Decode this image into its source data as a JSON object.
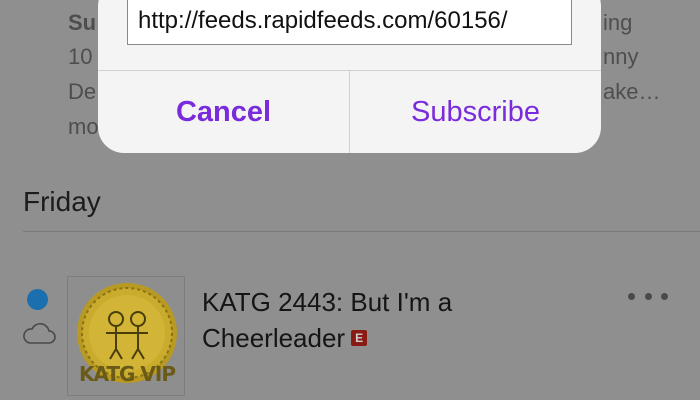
{
  "alert": {
    "url_value": "http://feeds.rapidfeeds.com/60156/",
    "cancel_label": "Cancel",
    "subscribe_label": "Subscribe",
    "accent_color": "#7a2bdc"
  },
  "background": {
    "summary_lines": [
      "Su",
      "10",
      "De",
      "mo"
    ],
    "summary_right_fragments": [
      "ing",
      "nny",
      "ake…"
    ]
  },
  "section": {
    "header": "Friday"
  },
  "episode": {
    "title": "KATG 2443: But I'm a Cheerleader",
    "explicit_badge": "E",
    "artwork_caption": "KATG VIP",
    "unplayed_color": "#1b6fae",
    "icons": [
      "unplayed-dot",
      "cloud-icon",
      "more-icon"
    ]
  }
}
